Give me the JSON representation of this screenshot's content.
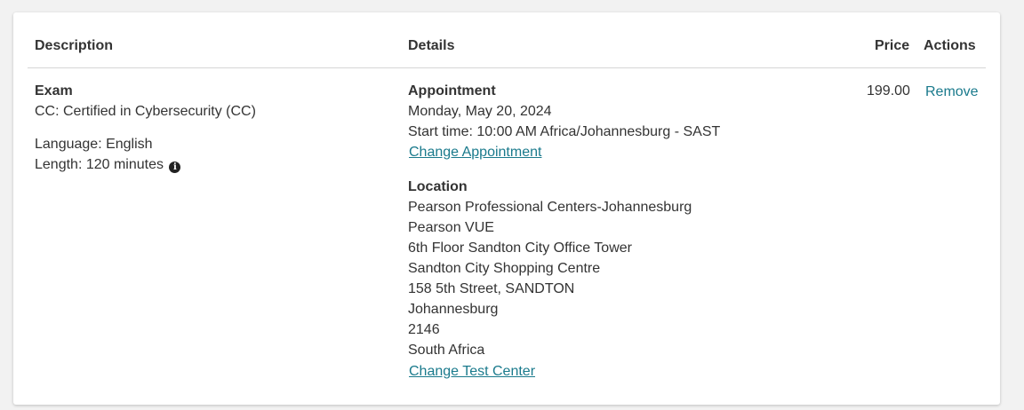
{
  "table": {
    "headers": {
      "description": "Description",
      "details": "Details",
      "price": "Price",
      "actions": "Actions"
    }
  },
  "row": {
    "description": {
      "type": "Exam",
      "name": "CC: Certified in Cybersecurity (CC)",
      "language": "Language: English",
      "length": "Length: 120 minutes",
      "length_info_icon": "info-circle-icon"
    },
    "details": {
      "appointment_heading": "Appointment",
      "date": "Monday, May 20, 2024",
      "start_time": "Start time: 10:00 AM Africa/Johannesburg - SAST",
      "change_appointment_link": "Change Appointment",
      "location_heading": "Location",
      "location_lines": [
        "Pearson Professional Centers-Johannesburg",
        "Pearson VUE",
        "6th Floor Sandton City Office Tower",
        "Sandton City Shopping Centre",
        "158 5th Street, SANDTON",
        "Johannesburg",
        "2146",
        "South Africa"
      ],
      "change_test_center_link": "Change Test Center"
    },
    "price": "199.00",
    "action_remove": "Remove"
  },
  "colors": {
    "link": "#1a7a8c",
    "text": "#333333",
    "background": "#f2f2f2",
    "card": "#ffffff"
  }
}
